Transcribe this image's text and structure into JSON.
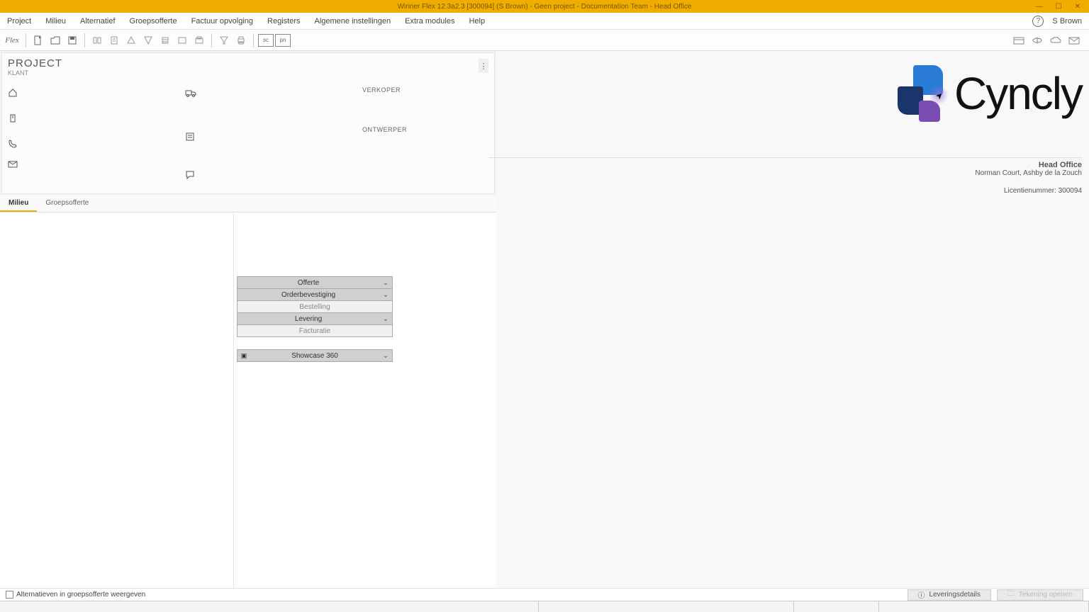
{
  "titlebar": {
    "text": "Winner Flex 12.3a2.3  [300094]  (S Brown) - Geen project - Documentation Team - Head Office"
  },
  "menu": {
    "items": [
      "Project",
      "Milieu",
      "Alternatief",
      "Groepsofferte",
      "Factuur opvolging",
      "Registers",
      "Algemene instellingen",
      "Extra modules",
      "Help"
    ],
    "user": "S Brown"
  },
  "toolbar": {
    "flex": "Flex",
    "sc": "sc",
    "pn": "pn"
  },
  "project": {
    "title": "PROJECT",
    "subtitle": "KLANT",
    "labels": {
      "verkoper": "VERKOPER",
      "ontwerper": "ONTWERPER"
    }
  },
  "tabs": {
    "milieu": "Milieu",
    "groepsofferte": "Groepsofferte"
  },
  "dropdowns": {
    "offerte": "Offerte",
    "orderbevestiging": "Orderbevestiging",
    "bestelling": "Bestelling",
    "levering": "Levering",
    "facturatie": "Facturatie",
    "showcase": "Showcase 360"
  },
  "brand": {
    "name": "Cyncly",
    "office": "Head Office",
    "address": "Norman Court,  Ashby de la Zouch",
    "license": "Licentienummer: 300094"
  },
  "footer": {
    "checkbox": "Alternatieven in groepsofferte weergeven",
    "leveringsdetails": "Leveringsdetails",
    "tekening": "Tekening openen"
  }
}
